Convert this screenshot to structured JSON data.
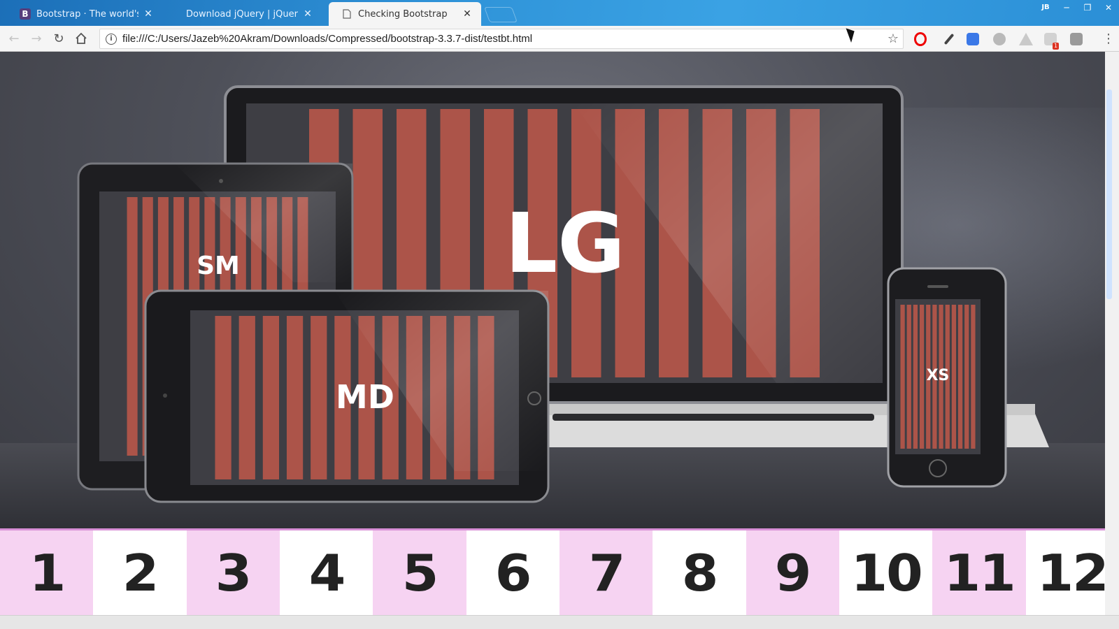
{
  "browser": {
    "tabs": [
      {
        "label": "Bootstrap · The world's m",
        "favicon": "B",
        "active": false
      },
      {
        "label": "Download jQuery | jQuer",
        "active": false
      },
      {
        "label": "Checking Bootstrap",
        "active": true
      }
    ],
    "close_glyph": "✕",
    "user_badge": "JB",
    "window_buttons": {
      "minimize": "─",
      "restore": "❐",
      "close": "✕"
    },
    "url": "file:///C:/Users/Jazeb%20Akram/Downloads/Compressed/bootstrap-3.3.7-dist/testbt.html",
    "extension_badge_count": "1"
  },
  "hero": {
    "labels": {
      "lg": "LG",
      "sm": "SM",
      "md": "MD",
      "xs": "XS"
    },
    "colors": {
      "bar": "#b5564a",
      "background": "#4e5059"
    }
  },
  "grid": {
    "columns": [
      "1",
      "2",
      "3",
      "4",
      "5",
      "6",
      "7",
      "8",
      "9",
      "10",
      "11",
      "12"
    ],
    "colors": {
      "pink": "#f6d3f2",
      "white": "#ffffff",
      "border": "#d88fd6"
    }
  }
}
